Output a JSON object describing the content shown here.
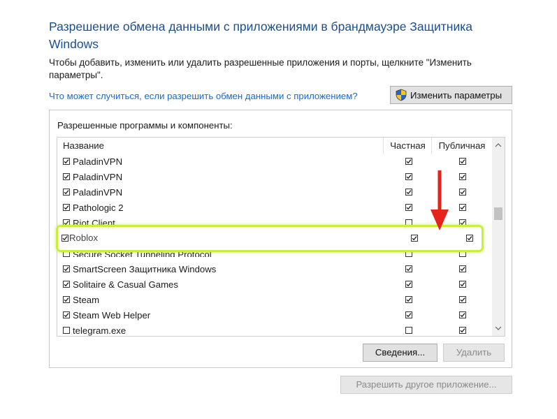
{
  "header": {
    "title": "Разрешение обмена данными с приложениями в брандмауэре Защитника Windows",
    "description": "Чтобы добавить, изменить или удалить разрешенные приложения и порты, щелкните \"Изменить параметры\".",
    "help_link": "Что может случиться, если разрешить обмен данными с приложением?",
    "change_settings_label": "Изменить параметры"
  },
  "group": {
    "label": "Разрешенные программы и компоненты:",
    "columns": {
      "name": "Название",
      "private": "Частная",
      "public": "Публичная"
    },
    "rows": [
      {
        "name": "PaladinVPN",
        "enabled": true,
        "private": true,
        "public": true
      },
      {
        "name": "PaladinVPN",
        "enabled": true,
        "private": true,
        "public": true
      },
      {
        "name": "PaladinVPN",
        "enabled": true,
        "private": true,
        "public": true
      },
      {
        "name": "Pathologic 2",
        "enabled": true,
        "private": true,
        "public": true
      },
      {
        "name": "Riot Client",
        "enabled": true,
        "private": false,
        "public": true
      },
      {
        "name": "Roblox",
        "enabled": true,
        "private": true,
        "public": true,
        "highlighted": true
      },
      {
        "name": "Secure Socket Tunneling Protocol",
        "enabled": false,
        "private": false,
        "public": false
      },
      {
        "name": "SmartScreen Защитника Windows",
        "enabled": true,
        "private": true,
        "public": true
      },
      {
        "name": "Solitaire & Casual Games",
        "enabled": true,
        "private": true,
        "public": true
      },
      {
        "name": "Steam",
        "enabled": true,
        "private": true,
        "public": true
      },
      {
        "name": "Steam Web Helper",
        "enabled": true,
        "private": true,
        "public": true
      },
      {
        "name": "telegram.exe",
        "enabled": false,
        "private": false,
        "public": true
      }
    ],
    "details_label": "Сведения...",
    "delete_label": "Удалить"
  },
  "footer": {
    "allow_other_label": "Разрешить другое приложение..."
  },
  "colors": {
    "title": "#1b4f8c",
    "link": "#1b6ac9",
    "highlight": "#c6f03a",
    "arrow": "#e5221c"
  },
  "icons": {
    "change_settings": "uac-shield-icon",
    "annotation": "red-down-arrow-icon"
  }
}
